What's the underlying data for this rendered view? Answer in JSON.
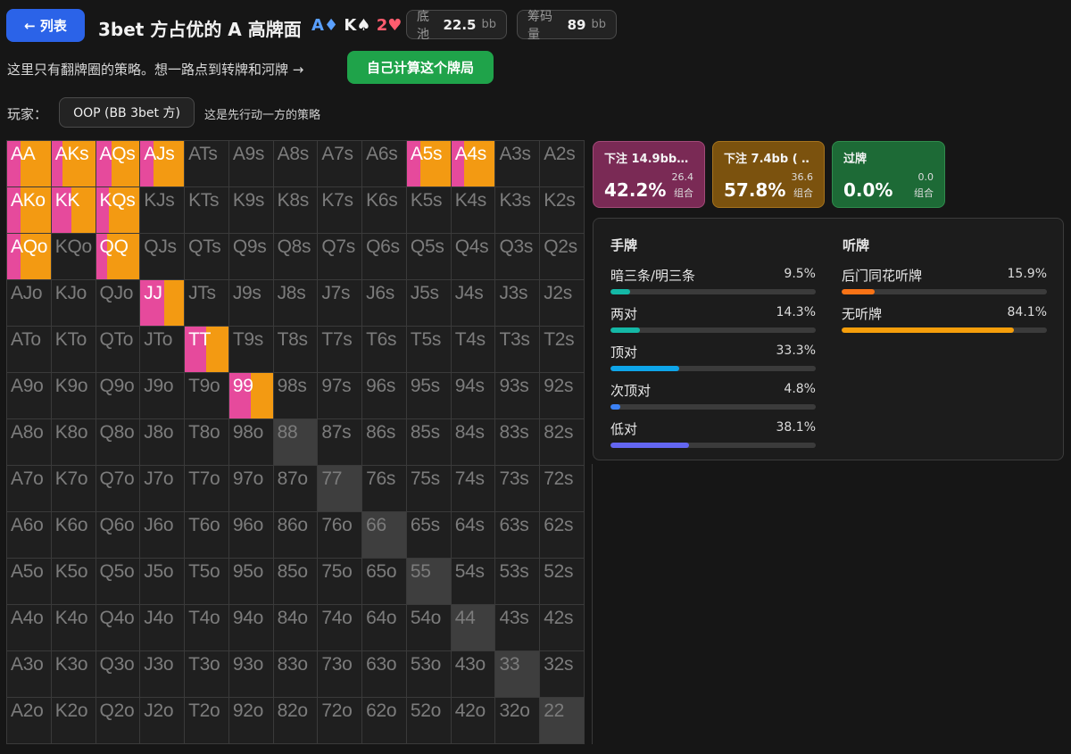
{
  "header": {
    "back_label": "← 列表",
    "title": "3bet 方占优的 A 高牌面",
    "board": [
      {
        "rank": "A",
        "suit": "♦",
        "color": "#5aa0ff"
      },
      {
        "rank": "K",
        "suit": "♠",
        "color": "#f2f2f2"
      },
      {
        "rank": "2",
        "suit": "♥",
        "color": "#ff5c6e"
      }
    ],
    "pot": {
      "label": "底池",
      "value": "22.5",
      "unit": "bb"
    },
    "stack": {
      "label": "筹码量",
      "value": "89",
      "unit": "bb"
    }
  },
  "note": "这里只有翻牌圈的策略。想一路点到转牌和河牌 →",
  "calc_button": "自己计算这个牌局",
  "player": {
    "label": "玩家：",
    "selected": "OOP (BB 3bet 方)",
    "note": "这是先行动一方的策略"
  },
  "grid": {
    "rows": [
      [
        "AA",
        "AKs",
        "AQs",
        "AJs",
        "ATs",
        "A9s",
        "A8s",
        "A7s",
        "A6s",
        "A5s",
        "A4s",
        "A3s",
        "A2s"
      ],
      [
        "AKo",
        "KK",
        "KQs",
        "KJs",
        "KTs",
        "K9s",
        "K8s",
        "K7s",
        "K6s",
        "K5s",
        "K4s",
        "K3s",
        "K2s"
      ],
      [
        "AQo",
        "KQo",
        "QQ",
        "QJs",
        "QTs",
        "Q9s",
        "Q8s",
        "Q7s",
        "Q6s",
        "Q5s",
        "Q4s",
        "Q3s",
        "Q2s"
      ],
      [
        "AJo",
        "KJo",
        "QJo",
        "JJ",
        "JTs",
        "J9s",
        "J8s",
        "J7s",
        "J6s",
        "J5s",
        "J4s",
        "J3s",
        "J2s"
      ],
      [
        "ATo",
        "KTo",
        "QTo",
        "JTo",
        "TT",
        "T9s",
        "T8s",
        "T7s",
        "T6s",
        "T5s",
        "T4s",
        "T3s",
        "T2s"
      ],
      [
        "A9o",
        "K9o",
        "Q9o",
        "J9o",
        "T9o",
        "99",
        "98s",
        "97s",
        "96s",
        "95s",
        "94s",
        "93s",
        "92s"
      ],
      [
        "A8o",
        "K8o",
        "Q8o",
        "J8o",
        "T8o",
        "98o",
        "88",
        "87s",
        "86s",
        "85s",
        "84s",
        "83s",
        "82s"
      ],
      [
        "A7o",
        "K7o",
        "Q7o",
        "J7o",
        "T7o",
        "97o",
        "87o",
        "77",
        "76s",
        "75s",
        "74s",
        "73s",
        "72s"
      ],
      [
        "A6o",
        "K6o",
        "Q6o",
        "J6o",
        "T6o",
        "96o",
        "86o",
        "76o",
        "66",
        "65s",
        "64s",
        "63s",
        "62s"
      ],
      [
        "A5o",
        "K5o",
        "Q5o",
        "J5o",
        "T5o",
        "95o",
        "85o",
        "75o",
        "65o",
        "55",
        "54s",
        "53s",
        "52s"
      ],
      [
        "A4o",
        "K4o",
        "Q4o",
        "J4o",
        "T4o",
        "94o",
        "84o",
        "74o",
        "64o",
        "54o",
        "44",
        "43s",
        "42s"
      ],
      [
        "A3o",
        "K3o",
        "Q3o",
        "J3o",
        "T3o",
        "93o",
        "83o",
        "73o",
        "63o",
        "53o",
        "43o",
        "33",
        "32s"
      ],
      [
        "A2o",
        "K2o",
        "Q2o",
        "J2o",
        "T2o",
        "92o",
        "82o",
        "72o",
        "62o",
        "52o",
        "42o",
        "32o",
        "22"
      ]
    ],
    "strategy": {
      "AA": [
        0.3,
        0.7
      ],
      "AKs": [
        0.25,
        0.75
      ],
      "AQs": [
        0.35,
        0.65
      ],
      "AJs": [
        0.3,
        0.7
      ],
      "A5s": [
        0.3,
        0.7
      ],
      "A4s": [
        0.3,
        0.7
      ],
      "AKo": [
        0.3,
        0.7
      ],
      "KK": [
        0.45,
        0.55
      ],
      "KQs": [
        0.3,
        0.7
      ],
      "AQo": [
        0.3,
        0.7
      ],
      "QQ": [
        0.25,
        0.75
      ],
      "JJ": [
        0.55,
        0.45
      ],
      "TT": [
        0.5,
        0.5
      ],
      "99": [
        0.5,
        0.5
      ]
    }
  },
  "actions": [
    {
      "name": "下注 14.9bb…",
      "pct": "42.2%",
      "combos": "26.4",
      "combos_label": "组合"
    },
    {
      "name": "下注 7.4bb ( …",
      "pct": "57.8%",
      "combos": "36.6",
      "combos_label": "组合"
    },
    {
      "name": "过牌",
      "pct": "0.0%",
      "combos": "0.0",
      "combos_label": "组合"
    }
  ],
  "stats": {
    "hands_title": "手牌",
    "hands": [
      {
        "name": "暗三条/明三条",
        "value": "9.5%",
        "pct": 9.5,
        "color": "#14b8a6"
      },
      {
        "name": "两对",
        "value": "14.3%",
        "pct": 14.3,
        "color": "#14b8a6"
      },
      {
        "name": "顶对",
        "value": "33.3%",
        "pct": 33.3,
        "color": "#0ea5e9"
      },
      {
        "name": "次顶对",
        "value": "4.8%",
        "pct": 4.8,
        "color": "#3b82f6"
      },
      {
        "name": "低对",
        "value": "38.1%",
        "pct": 38.1,
        "color": "#6366f1"
      }
    ],
    "draws_title": "听牌",
    "draws": [
      {
        "name": "后门同花听牌",
        "value": "15.9%",
        "pct": 15.9,
        "color": "#f97316"
      },
      {
        "name": "无听牌",
        "value": "84.1%",
        "pct": 84.1,
        "color": "#f59e0b"
      }
    ]
  }
}
